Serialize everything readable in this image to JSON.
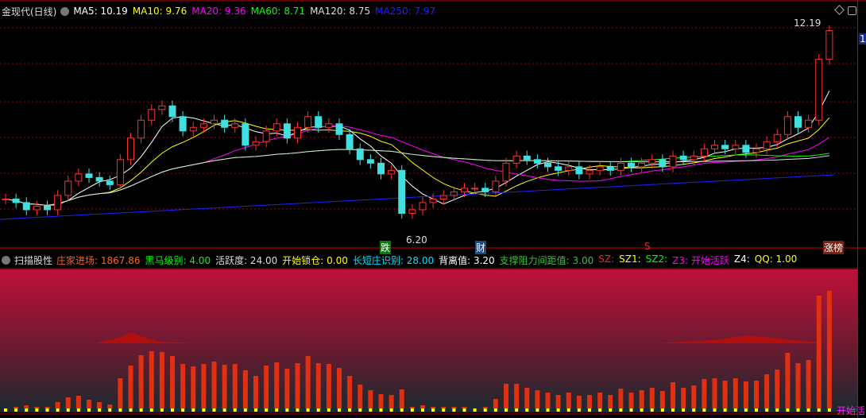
{
  "header": {
    "title": "金现代(日线)",
    "ma": [
      {
        "label": "MA5: 10.19",
        "color": "#ffffff"
      },
      {
        "label": "MA10: 9.76",
        "color": "#ffff00"
      },
      {
        "label": "MA20: 9.36",
        "color": "#ff00ff"
      },
      {
        "label": "MA60: 8.71",
        "color": "#00ff00"
      },
      {
        "label": "MA120: 8.75",
        "color": "#dddddd"
      },
      {
        "label": "MA250: 7.97",
        "color": "#2020ff"
      }
    ]
  },
  "annotations": {
    "high": "12.19",
    "low": "6.20",
    "right_tag": "1"
  },
  "markers": [
    {
      "text": "跌",
      "bg": "#0a7a0a"
    },
    {
      "text": "财",
      "bg": "#1a4a8a"
    },
    {
      "text": "S",
      "bg": "transparent"
    },
    {
      "text": "涨榜",
      "bg": "#7a2010"
    }
  ],
  "indicator": {
    "name": "扫描股性",
    "items": [
      {
        "label": "庄家进场: 1867.86",
        "color": "#ff6020"
      },
      {
        "label": "黑马级别: 4.00",
        "color": "#00ff00"
      },
      {
        "label": "活跃度: 24.00",
        "color": "#dddddd"
      },
      {
        "label": "开始锁仓: 0.00",
        "color": "#ffff00"
      },
      {
        "label": "长短庄识别: 28.00",
        "color": "#00e0ff"
      },
      {
        "label": "背离值: 3.20",
        "color": "#ffffff"
      },
      {
        "label": "支撑阻力间距值: 3.00",
        "color": "#40c040"
      },
      {
        "label": "SZ:",
        "color": "#ff2020"
      },
      {
        "label": "SZ1:",
        "color": "#ffff00"
      },
      {
        "label": "SZ2:",
        "color": "#00ff00"
      },
      {
        "label": "Z3: 开始活跃",
        "color": "#ff00ff"
      },
      {
        "label": "Z4:",
        "color": "#ffffff"
      },
      {
        "label": "QQ: 1.00",
        "color": "#ffff00"
      }
    ],
    "bottom_tag": "开始活"
  },
  "chart_data": {
    "type": "candlestick",
    "closes": [
      7.3,
      7.2,
      7.0,
      7.1,
      7.0,
      7.4,
      7.8,
      8.0,
      7.9,
      7.8,
      7.7,
      8.4,
      9.0,
      9.5,
      9.8,
      9.9,
      9.6,
      9.2,
      9.3,
      9.4,
      9.5,
      9.3,
      9.4,
      8.8,
      8.9,
      9.2,
      9.4,
      9.0,
      9.3,
      9.6,
      9.3,
      9.4,
      9.1,
      8.7,
      8.4,
      8.3,
      8.0,
      8.1,
      6.9,
      7.0,
      7.2,
      7.3,
      7.4,
      7.5,
      7.6,
      7.6,
      7.5,
      7.8,
      8.3,
      8.5,
      8.4,
      8.3,
      8.2,
      8.1,
      8.2,
      8.0,
      8.1,
      8.2,
      8.1,
      8.3,
      8.2,
      8.3,
      8.4,
      8.2,
      8.5,
      8.4,
      8.5,
      8.7,
      8.8,
      8.7,
      8.8,
      8.6,
      8.7,
      8.9,
      9.1,
      9.6,
      9.3,
      9.5,
      11.2,
      12.0
    ],
    "ylim": [
      6.2,
      12.19
    ]
  }
}
